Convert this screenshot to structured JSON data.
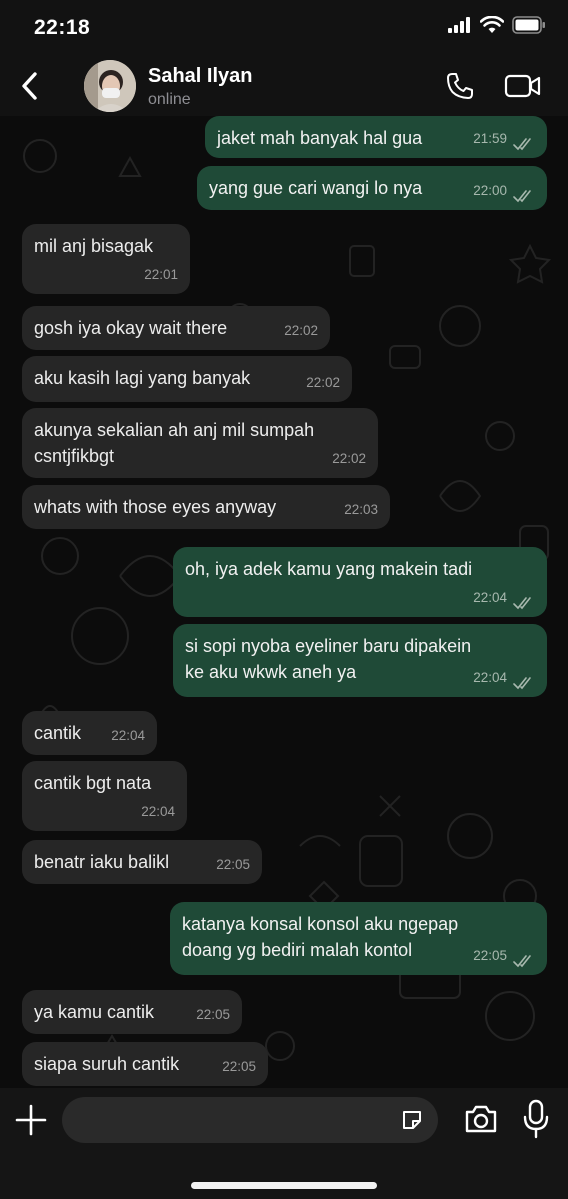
{
  "status_bar": {
    "time": "22:18",
    "icons": [
      "signal-icon",
      "wifi-icon",
      "battery-icon"
    ]
  },
  "header": {
    "back_icon": "chevron-left-icon",
    "contact_name": "Sahal Ilyan",
    "contact_status": "online",
    "call_icon": "phone-icon",
    "video_icon": "video-camera-icon"
  },
  "colors": {
    "incoming_bubble": "#262626",
    "outgoing_bubble": "#1f4a37",
    "background": "#0c0c0c",
    "header": "#121212"
  },
  "messages": [
    {
      "dir": "out",
      "text": "jaket mah banyak hal gua",
      "time": "21:59",
      "read": true
    },
    {
      "dir": "out",
      "text": "yang gue cari wangi lo nya",
      "time": "22:00",
      "read": true
    },
    {
      "dir": "in",
      "text": "mil anj bisagak",
      "time": "22:01"
    },
    {
      "dir": "in",
      "text": "gosh iya okay wait there",
      "time": "22:02"
    },
    {
      "dir": "in",
      "text": "aku kasih lagi yang banyak",
      "time": "22:02"
    },
    {
      "dir": "in",
      "text": "akunya sekalian ah anj mil sumpah\ncsntjfikbgt",
      "time": "22:02"
    },
    {
      "dir": "in",
      "text": "whats with those eyes anyway",
      "time": "22:03"
    },
    {
      "dir": "out",
      "text": "oh, iya adek kamu yang makein tadi",
      "time": "22:04",
      "read": true
    },
    {
      "dir": "out",
      "text": "si sopi nyoba eyeliner baru dipakein\nke aku wkwk aneh ya",
      "time": "22:04",
      "read": true
    },
    {
      "dir": "in",
      "text": "cantik",
      "time": "22:04"
    },
    {
      "dir": "in",
      "text": "cantik bgt nata",
      "time": "22:04"
    },
    {
      "dir": "in",
      "text": "benatr iaku balikl",
      "time": "22:05"
    },
    {
      "dir": "out",
      "text": "katanya konsal konsol aku ngepap\ndoang yg bediri malah kontol",
      "time": "22:05",
      "read": true
    },
    {
      "dir": "in",
      "text": "ya kamu cantik",
      "time": "22:05"
    },
    {
      "dir": "in",
      "text": "siapa suruh cantik",
      "time": "22:05"
    }
  ],
  "composer": {
    "input_value": "",
    "plus_icon": "plus-icon",
    "sticker_icon": "sticker-icon",
    "camera_icon": "camera-icon",
    "mic_icon": "microphone-icon"
  }
}
